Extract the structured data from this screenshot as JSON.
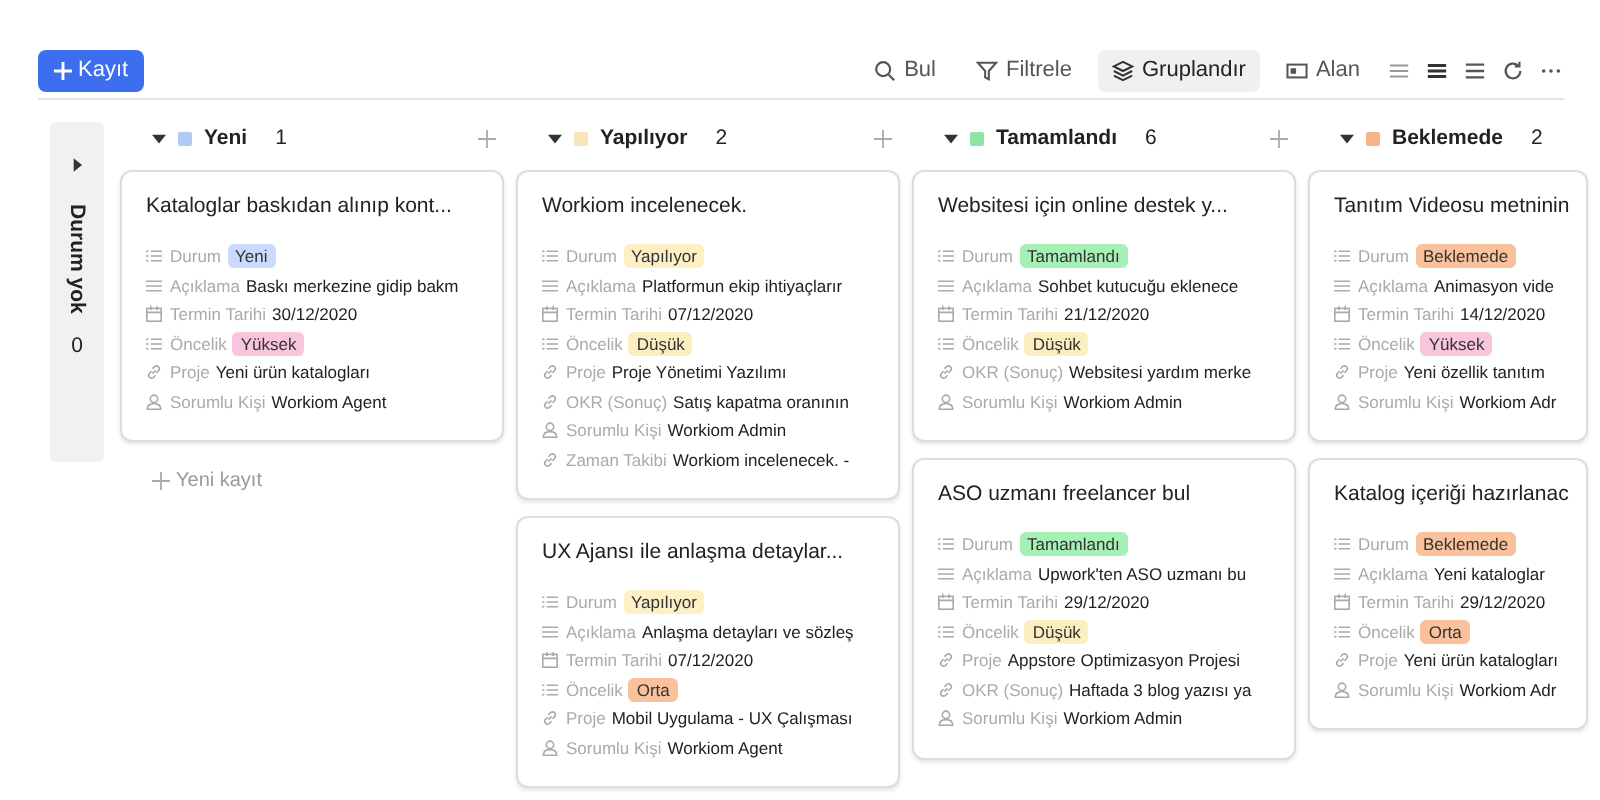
{
  "toolbar": {
    "add_button": "Kayıt",
    "actions": [
      {
        "label": "Bul",
        "selected": false
      },
      {
        "label": "Filtrele",
        "selected": false
      },
      {
        "label": "Gruplandır",
        "selected": true
      },
      {
        "label": "Alan",
        "selected": false
      }
    ]
  },
  "no_status_lane": {
    "label": "Durum yok",
    "count": "0"
  },
  "columns": [
    {
      "name": "Yeni",
      "color": "#b5c9f7",
      "count": "1",
      "new_record": "Yeni kayıt",
      "cards": [
        {
          "title": "Kataloglar baskıdan alınıp kont...",
          "fields": [
            {
              "kind": "choice",
              "label": "Durum",
              "value": "Yeni",
              "color": "#c9dafc"
            },
            {
              "kind": "longtext",
              "label": "Açıklama",
              "value": "Baskı merkezine gidip bakm"
            },
            {
              "kind": "date",
              "label": "Termin Tarihi",
              "value": "30/12/2020"
            },
            {
              "kind": "choice",
              "label": "Öncelik",
              "value": "Yüksek",
              "color": "#f8c5dc"
            },
            {
              "kind": "link",
              "label": "Proje",
              "value": "Yeni ürün katalogları"
            },
            {
              "kind": "person",
              "label": "Sorumlu Kişi",
              "value": "Workiom Agent"
            }
          ]
        }
      ]
    },
    {
      "name": "Yapılıyor",
      "color": "#f8e6b8",
      "count": "2",
      "cards": [
        {
          "title": "Workiom incelenecek.",
          "fields": [
            {
              "kind": "choice",
              "label": "Durum",
              "value": "Yapılıyor",
              "color": "#fdf0c4"
            },
            {
              "kind": "longtext",
              "label": "Açıklama",
              "value": "Platformun ekip ihtiyaçlarır"
            },
            {
              "kind": "date",
              "label": "Termin Tarihi",
              "value": "07/12/2020"
            },
            {
              "kind": "choice",
              "label": "Öncelik",
              "value": "Düşük",
              "color": "#fbeec0"
            },
            {
              "kind": "link",
              "label": "Proje",
              "value": "Proje Yönetimi Yazılımı"
            },
            {
              "kind": "link",
              "label": "OKR (Sonuç)",
              "value": "Satış kapatma oranının"
            },
            {
              "kind": "person",
              "label": "Sorumlu Kişi",
              "value": "Workiom Admin"
            },
            {
              "kind": "link",
              "label": "Zaman Takibi",
              "value": "Workiom incelenecek. -"
            }
          ]
        },
        {
          "title": "UX Ajansı ile anlaşma detaylar...",
          "fields": [
            {
              "kind": "choice",
              "label": "Durum",
              "value": "Yapılıyor",
              "color": "#fdf0c4"
            },
            {
              "kind": "longtext",
              "label": "Açıklama",
              "value": "Anlaşma detayları ve sözleş"
            },
            {
              "kind": "date",
              "label": "Termin Tarihi",
              "value": "07/12/2020"
            },
            {
              "kind": "choice",
              "label": "Öncelik",
              "value": "Orta",
              "color": "#f9c29c"
            },
            {
              "kind": "link",
              "label": "Proje",
              "value": "Mobil Uygulama - UX Çalışması"
            },
            {
              "kind": "person",
              "label": "Sorumlu Kişi",
              "value": "Workiom Agent"
            }
          ]
        }
      ]
    },
    {
      "name": "Tamamlandı",
      "color": "#8fe3a5",
      "count": "6",
      "cards": [
        {
          "title": "Websitesi için online destek y...",
          "fields": [
            {
              "kind": "choice",
              "label": "Durum",
              "value": "Tamamlandı",
              "color": "#a6f0b6"
            },
            {
              "kind": "longtext",
              "label": "Açıklama",
              "value": "Sohbet kutucuğu eklenece"
            },
            {
              "kind": "date",
              "label": "Termin Tarihi",
              "value": "21/12/2020"
            },
            {
              "kind": "choice",
              "label": "Öncelik",
              "value": "Düşük",
              "color": "#fbeec0"
            },
            {
              "kind": "link",
              "label": "OKR (Sonuç)",
              "value": "Websitesi yardım merke"
            },
            {
              "kind": "person",
              "label": "Sorumlu Kişi",
              "value": "Workiom Admin"
            }
          ]
        },
        {
          "title": "ASO uzmanı freelancer bul",
          "fields": [
            {
              "kind": "choice",
              "label": "Durum",
              "value": "Tamamlandı",
              "color": "#a6f0b6"
            },
            {
              "kind": "longtext",
              "label": "Açıklama",
              "value": "Upwork'ten ASO uzmanı bu"
            },
            {
              "kind": "date",
              "label": "Termin Tarihi",
              "value": "29/12/2020"
            },
            {
              "kind": "choice",
              "label": "Öncelik",
              "value": "Düşük",
              "color": "#fbeec0"
            },
            {
              "kind": "link",
              "label": "Proje",
              "value": "Appstore Optimizasyon Projesi"
            },
            {
              "kind": "link",
              "label": "OKR (Sonuç)",
              "value": "Haftada 3 blog yazısı ya"
            },
            {
              "kind": "person",
              "label": "Sorumlu Kişi",
              "value": "Workiom Admin"
            }
          ]
        }
      ]
    },
    {
      "name": "Beklemede",
      "color": "#f5b48a",
      "count": "2",
      "cards": [
        {
          "title": "Tanıtım Videosu metninin",
          "fields": [
            {
              "kind": "choice",
              "label": "Durum",
              "value": "Beklemede",
              "color": "#f9c29c"
            },
            {
              "kind": "longtext",
              "label": "Açıklama",
              "value": "Animasyon vide"
            },
            {
              "kind": "date",
              "label": "Termin Tarihi",
              "value": "14/12/2020"
            },
            {
              "kind": "choice",
              "label": "Öncelik",
              "value": "Yüksek",
              "color": "#f8c5dc"
            },
            {
              "kind": "link",
              "label": "Proje",
              "value": "Yeni özellik tanıtım"
            },
            {
              "kind": "person",
              "label": "Sorumlu Kişi",
              "value": "Workiom Adr"
            }
          ]
        },
        {
          "title": "Katalog içeriği hazırlanac",
          "fields": [
            {
              "kind": "choice",
              "label": "Durum",
              "value": "Beklemede",
              "color": "#f9c29c"
            },
            {
              "kind": "longtext",
              "label": "Açıklama",
              "value": "Yeni kataloglar"
            },
            {
              "kind": "date",
              "label": "Termin Tarihi",
              "value": "29/12/2020"
            },
            {
              "kind": "choice",
              "label": "Öncelik",
              "value": "Orta",
              "color": "#f9c29c"
            },
            {
              "kind": "link",
              "label": "Proje",
              "value": "Yeni ürün katalogları"
            },
            {
              "kind": "person",
              "label": "Sorumlu Kişi",
              "value": "Workiom Adr"
            }
          ]
        }
      ]
    }
  ]
}
